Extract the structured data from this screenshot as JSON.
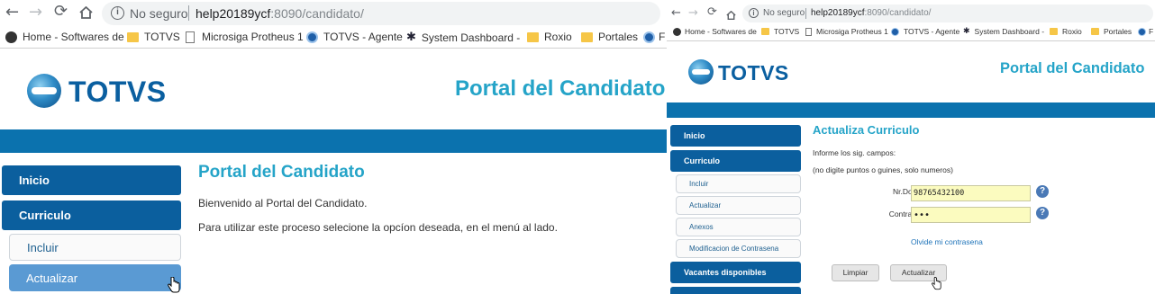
{
  "browser": {
    "security_label": "No seguro",
    "url_host": "help20189ycf",
    "url_rest": ":8090/candidato/",
    "bookmarks": [
      {
        "label": "Home - Softwares de",
        "icon": "totvs-dark-icon"
      },
      {
        "label": "TOTVS",
        "icon": "folder-icon"
      },
      {
        "label": "Microsiga Protheus 1",
        "icon": "page-icon"
      },
      {
        "label": "TOTVS - Agente",
        "icon": "totvs-circle-icon"
      },
      {
        "label": "System Dashboard -",
        "icon": "jira-icon"
      },
      {
        "label": "Roxio",
        "icon": "folder-icon"
      },
      {
        "label": "Portales",
        "icon": "folder-icon"
      },
      {
        "label": "F",
        "icon": "totvs-circle-icon"
      }
    ]
  },
  "left": {
    "logo_text": "TOTVS",
    "portal_title": "Portal del Candidato",
    "menu": {
      "inicio": "Inicio",
      "curriculo": "Curriculo",
      "incluir": "Incluir",
      "actualizar": "Actualizar"
    },
    "content": {
      "title": "Portal del Candidato",
      "welcome": "Bienvenido al Portal del Candidato.",
      "instructions": "Para utilizar este proceso selecione la opcíon deseada, en el menú al lado."
    }
  },
  "right": {
    "logo_text": "TOTVS",
    "portal_title": "Portal del Candidato",
    "menu": {
      "inicio": "Inicio",
      "curriculo": "Curriculo",
      "incluir": "Incluir",
      "actualizar": "Actualizar",
      "anexos": "Anexos",
      "modificacion": "Modificacion de Contrasena",
      "vacantes": "Vacantes disponibles"
    },
    "form": {
      "title": "Actualiza Curriculo",
      "instruction_1": "Informe los sig. campos:",
      "instruction_2": "(no digite puntos o guines, solo numeros)",
      "nrdoc_label": "Nr.Doc",
      "nrdoc_value": "98765432100",
      "password_label": "Contrasena:",
      "password_value": "•••",
      "forgot_link": "Olvide mi contrasena",
      "clear_button": "Limpiar",
      "update_button": "Actualizar",
      "help_glyph": "?"
    }
  }
}
